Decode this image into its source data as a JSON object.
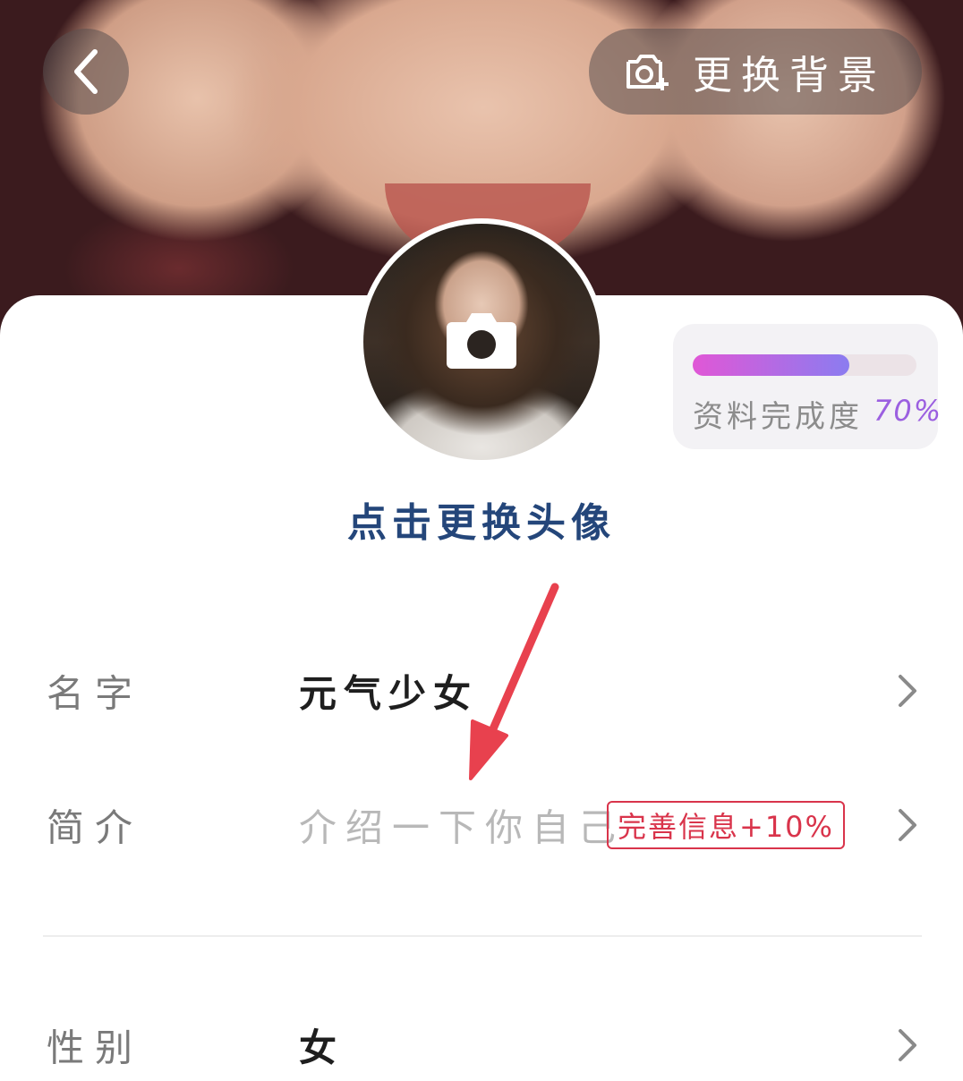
{
  "header": {
    "back_icon": "chevron-left-icon",
    "change_background_label": "更换背景",
    "camera_icon": "camera-plus-icon"
  },
  "avatar": {
    "camera_icon": "camera-icon",
    "change_avatar_label": "点击更换头像"
  },
  "completion": {
    "label": "资料完成度",
    "value_text": "70%",
    "progress": 0.7,
    "gradient_start": "#e057d6",
    "gradient_end": "#8b7cf0"
  },
  "fields": {
    "name": {
      "label": "名字",
      "value": "元气少女"
    },
    "bio": {
      "label": "简介",
      "placeholder": "介绍一下你自己",
      "badge": "完善信息+10%"
    },
    "gender": {
      "label": "性别",
      "value": "女"
    }
  },
  "colors": {
    "accent_text": "#24467a",
    "badge_red": "#d9344b",
    "annotation_arrow": "#e8414e"
  }
}
